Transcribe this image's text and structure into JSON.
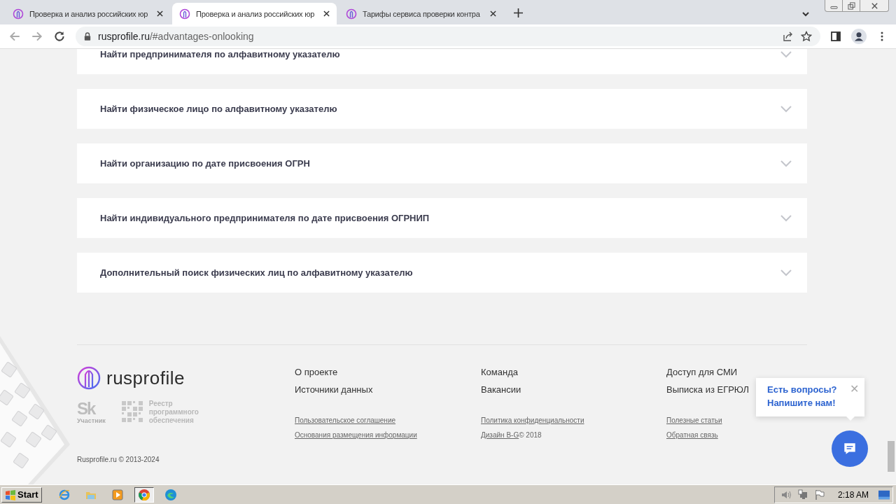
{
  "browser": {
    "tabs": [
      {
        "title": "Проверка и анализ российских юр",
        "selected": false
      },
      {
        "title": "Проверка и анализ российских юр",
        "selected": true
      },
      {
        "title": "Тарифы сервиса проверки контра",
        "selected": false
      }
    ],
    "address": {
      "host": "rusprofile.ru",
      "path": "/#advantages-onlooking"
    }
  },
  "accordion": [
    {
      "title": "Найти предпринимателя по алфавитному указателю",
      "expanded": false
    },
    {
      "title": "Найти физическое лицо по алфавитному указателю",
      "expanded": false
    },
    {
      "title": "Найти организацию по дате присвоения ОГРН",
      "expanded": false
    },
    {
      "title": "Найти индивидуального предпринимателя по дате присвоения ОГРНИП",
      "expanded": false
    },
    {
      "title": "Дополнительный поиск физических лиц по алфавитному указателю",
      "expanded": false
    }
  ],
  "footer": {
    "logo": "rusprofile",
    "badges": {
      "sk": "Sk",
      "sk_caption": "Участник",
      "registry": [
        "Реестр",
        "программного",
        "обеспечения"
      ]
    },
    "columns": [
      {
        "links": [
          "О проекте",
          "Источники данных"
        ],
        "small_links": [
          {
            "link": "Пользовательское соглашение"
          },
          {
            "link": "Основания размещения информации"
          }
        ]
      },
      {
        "links": [
          "Команда",
          "Вакансии"
        ],
        "small_links": [
          {
            "link": "Политика конфиденциальности"
          },
          {
            "link": "Дизайн B-G",
            "suffix": " © 2018"
          }
        ]
      },
      {
        "links": [
          "Доступ для СМИ",
          "Выписка из ЕГРЮЛ"
        ],
        "small_links": [
          {
            "link": "Полезные статьи"
          },
          {
            "link": "Обратная связь"
          }
        ]
      }
    ],
    "copyright": "Rusprofile.ru © 2013-2024"
  },
  "chat_popup": {
    "lines": [
      "Есть вопросы?",
      "Напишите нам!"
    ],
    "close": "✕"
  },
  "taskbar": {
    "start": "Start",
    "apps": [
      {
        "kind": "ie",
        "selected": false
      },
      {
        "kind": "folder",
        "selected": false
      },
      {
        "kind": "media",
        "selected": false
      },
      {
        "kind": "chrome",
        "selected": true
      },
      {
        "kind": "edge",
        "selected": false
      }
    ],
    "clock": "2:18 AM"
  }
}
